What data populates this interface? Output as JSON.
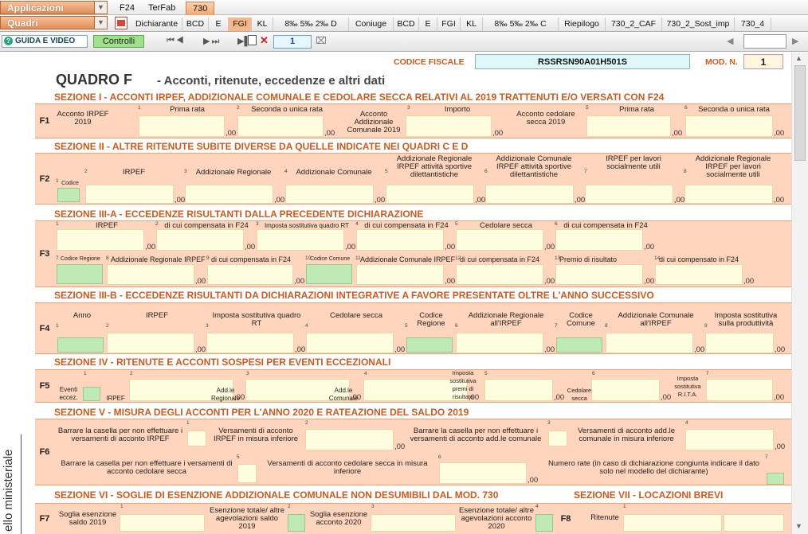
{
  "menu": {
    "app_combo": "Applicazioni",
    "quadri_combo": "Quadri",
    "guida": "GUIDA E VIDEO",
    "controlli": "Controlli",
    "page": "1"
  },
  "top_tabs": [
    "F24",
    "TerFab",
    "730"
  ],
  "quadri_tabs": [
    "Dichiarante",
    "BCD",
    "E",
    "FGI",
    "KL",
    "8‰ 5‰ 2‰ D",
    "Coniuge",
    "BCD",
    "E",
    "FGI",
    "KL",
    "8‰ 5‰ 2‰ C",
    "Riepilogo",
    "730_2_CAF",
    "730_2_Sost_imp",
    "730_4"
  ],
  "header": {
    "cf_label": "CODICE FISCALE",
    "cf_value": "RSSRSN90A01H501S",
    "mod_label": "MOD. N.",
    "mod_value": "1"
  },
  "title": "QUADRO F",
  "subtitle": "- Acconti, ritenute, eccedenze e altri dati",
  "zero": ",00",
  "sections": {
    "s1": "SEZIONE I  -  ACCONTI IRPEF, ADDIZIONALE COMUNALE E CEDOLARE SECCA RELATIVI AL 2019 TRATTENUTI E/O VERSATI CON F24",
    "s2": "SEZIONE II  -  ALTRE RITENUTE SUBITE DIVERSE DA QUELLE INDICATE NEI QUADRI C E D",
    "s3a": "SEZIONE III-A  -  ECCEDENZE RISULTANTI DALLA PRECEDENTE DICHIARAZIONE",
    "s3b": "SEZIONE III-B  -  ECCEDENZE RISULTANTI DA DICHIARAZIONI INTEGRATIVE A FAVORE PRESENTATE OLTRE L'ANNO SUCCESSIVO",
    "s4": "SEZIONE IV  -  RITENUTE E ACCONTI SOSPESI PER EVENTI ECCEZIONALI",
    "s5": "SEZIONE V  -  MISURA DEGLI ACCONTI PER L'ANNO 2020 E RATEAZIONE DEL SALDO 2019",
    "s6": "SEZIONE VI  -  SOGLIE DI ESENZIONE ADDIZIONALE COMUNALE NON DESUMIBILI DAL MOD. 730",
    "s7": "SEZIONE VII  -  LOCAZIONI BREVI"
  },
  "rows": {
    "f1": "F1",
    "f2": "F2",
    "f3": "F3",
    "f4": "F4",
    "f5": "F5",
    "f6": "F6",
    "f7": "F7",
    "f8": "F8"
  },
  "f1": {
    "acc_irpef": "Acconto IRPEF 2019",
    "prima": "Prima rata",
    "seconda": "Seconda o unica rata",
    "acc_add": "Acconto Addizionale Comunale 2019",
    "importo": "Importo",
    "acc_ced": "Acconto cedolare secca 2019",
    "prima2": "Prima rata",
    "seconda2": "Seconda o unica rata"
  },
  "f2": {
    "codice": "Codice",
    "irpef": "IRPEF",
    "add_reg": "Addizionale Regionale",
    "add_com": "Addizionale Comunale",
    "add_reg_sport": "Addizionale Regionale IRPEF attività sportive dilettantistiche",
    "add_com_sport": "Addizionale Comunale IRPEF attività sportive dilettantistiche",
    "irpef_lsu": "IRPEF per lavori socialmente utili",
    "add_reg_lsu": "Addizionale Regionale IRPEF per lavori socialmente utili"
  },
  "f3": {
    "irpef": "IRPEF",
    "dicui1": "di cui compensata in F24",
    "imp_sost": "Imposta sostitutiva quadro RT",
    "dicui2": "di cui compensata in F24",
    "ced": "Cedolare secca",
    "dicui3": "di cui compensata in F24",
    "cod_reg": "Codice Regione",
    "add_reg": "Addizionale Regionale IRPEF",
    "dicui4": "di cui compensata in F24",
    "cod_com": "Codice Comune",
    "add_com": "Addizionale Comunale IRPEF",
    "dicui5": "di cui compensata in F24",
    "premio": "Premio di risultato",
    "dicui6": "di cui compensato in F24"
  },
  "f4": {
    "anno": "Anno",
    "irpef": "IRPEF",
    "imp_rt": "Imposta sostitutiva quadro RT",
    "ced": "Cedolare secca",
    "cod_reg": "Codice Regione",
    "add_reg": "Addizionale Regionale all'IRPEF",
    "cod_com": "Codice Comune",
    "add_com": "Addizionale Comunale all'IRPEF",
    "imp_prod": "Imposta sostitutiva sulla produttività"
  },
  "f5": {
    "eventi": "Eventi eccez.",
    "irpef": "IRPEF",
    "add_reg": "Add.le Regionale",
    "add_com": "Add.le Comunale",
    "imp_premi": "Imposta sostitutiva premi di risultato",
    "ced": "Cedolare secca",
    "imp_rita": "Imposta sostitutiva R.I.T.A."
  },
  "f6": {
    "barr1": "Barrare la casella per non effettuare i versamenti di acconto IRPEF",
    "vers1": "Versamenti di acconto IRPEF in misura inferiore",
    "barr2": "Barrare la casella per non effettuare i versamenti di acconto add.le comunale",
    "vers2": "Versamenti di acconto add.le comunale in misura inferiore",
    "barr3": "Barrare la casella per non effettuare i versamenti di acconto cedolare secca",
    "vers3": "Versamenti di acconto cedolare secca in misura inferiore",
    "rate": "Numero rate (in caso di dichiarazione congiunta indicare il dato solo nel modello del dichiarante)"
  },
  "f7": {
    "soglia1": "Soglia esenzione saldo 2019",
    "esenz1": "Esenzione totale/ altre agevolazioni saldo 2019",
    "soglia2": "Soglia esenzione acconto 2020",
    "esenz2": "Esenzione totale/ altre agevolazioni acconto 2020"
  },
  "f8": {
    "ritenute": "Ritenute"
  },
  "side_text": "ello ministeriale",
  "colors": {
    "accent": "#cf5a1d",
    "band": "#ffd5bd",
    "input": "#fffde0",
    "green": "#bfe9b5"
  }
}
